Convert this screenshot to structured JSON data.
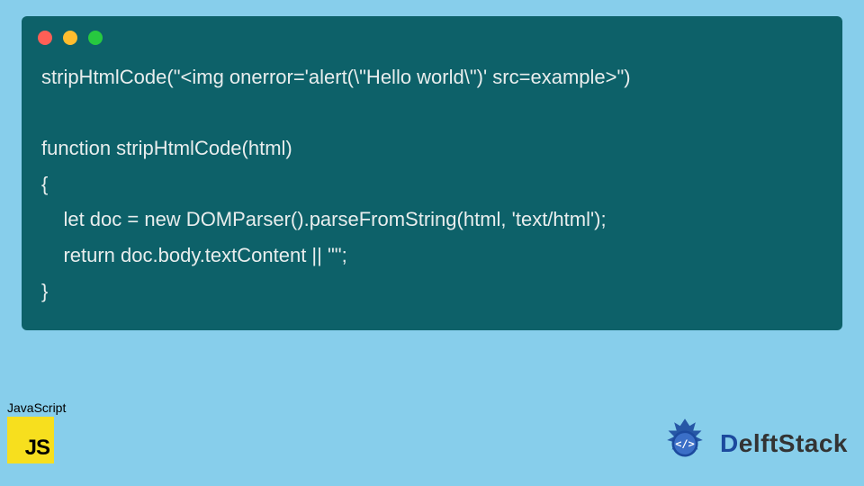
{
  "code": {
    "line1": "stripHtmlCode(\"<img onerror='alert(\\\"Hello world\\\")' src=example>\")",
    "line2": "",
    "line3": "function stripHtmlCode(html)",
    "line4": "{",
    "line5": "    let doc = new DOMParser().parseFromString(html, 'text/html');",
    "line6": "    return doc.body.textContent || \"\";",
    "line7": "}"
  },
  "window": {
    "dot_colors": {
      "red": "#ff5f56",
      "yellow": "#ffbd2e",
      "green": "#27c93f"
    }
  },
  "js_badge": {
    "label": "JavaScript",
    "logo_text": "JS"
  },
  "delft": {
    "text_first": "D",
    "text_rest": "elftStack"
  },
  "colors": {
    "page_bg": "#87ceeb",
    "code_bg": "#0d6169",
    "code_fg": "#e8eded",
    "js_yellow": "#f7df1e",
    "delft_blue": "#1c4a9e"
  }
}
